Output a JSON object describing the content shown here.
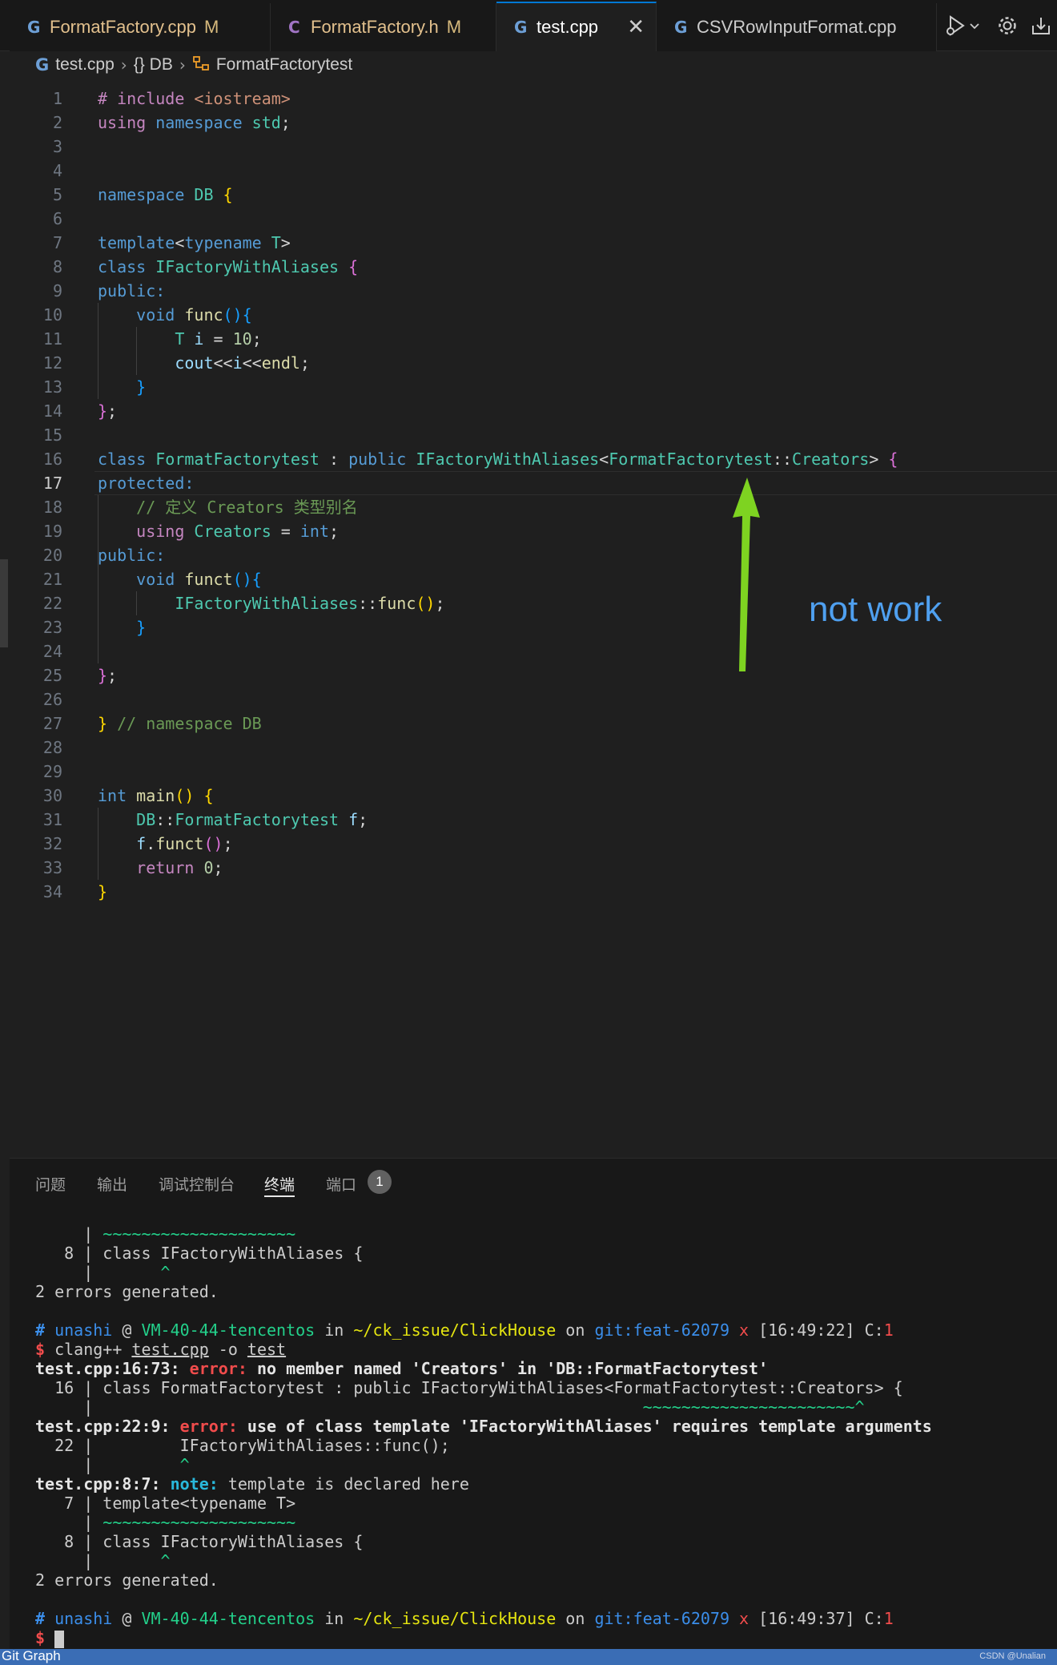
{
  "tabs": [
    {
      "label": "FormatFactory.cpp",
      "modified": "M",
      "icon": "cpp-file-icon",
      "color": "#e2c08d"
    },
    {
      "label": "FormatFactory.h",
      "modified": "M",
      "icon": "c-header-file-icon",
      "color": "#e2c08d"
    },
    {
      "label": "test.cpp",
      "modified": "",
      "icon": "cpp-file-icon",
      "active": true,
      "close": "✕"
    },
    {
      "label": "CSVRowInputFormat.cpp",
      "modified": "",
      "icon": "cpp-file-icon"
    }
  ],
  "toolbar_icons": [
    "run-debug-icon",
    "chevron-down-icon",
    "gear-icon",
    "download-icon"
  ],
  "breadcrumb": {
    "file": "test.cpp",
    "namespace": "{} DB",
    "symbol": "FormatFactorytest"
  },
  "editor": {
    "current_line": 17,
    "lines": [
      {
        "n": "1",
        "tokens": [
          {
            "t": "# include ",
            "c": "k2"
          },
          {
            "t": "<iostream>",
            "c": "s"
          }
        ]
      },
      {
        "n": "2",
        "tokens": [
          {
            "t": "using ",
            "c": "k2"
          },
          {
            "t": "namespace ",
            "c": "k"
          },
          {
            "t": "std",
            "c": "t"
          },
          {
            "t": ";",
            "c": "p"
          }
        ]
      },
      {
        "n": "3",
        "tokens": []
      },
      {
        "n": "4",
        "tokens": []
      },
      {
        "n": "5",
        "tokens": [
          {
            "t": "namespace ",
            "c": "k"
          },
          {
            "t": "DB ",
            "c": "t"
          },
          {
            "t": "{",
            "c": "b1"
          }
        ]
      },
      {
        "n": "6",
        "tokens": []
      },
      {
        "n": "7",
        "tokens": [
          {
            "t": "template",
            "c": "k"
          },
          {
            "t": "<",
            "c": "p"
          },
          {
            "t": "typename ",
            "c": "k"
          },
          {
            "t": "T",
            "c": "t"
          },
          {
            "t": ">",
            "c": "p"
          }
        ]
      },
      {
        "n": "8",
        "tokens": [
          {
            "t": "class ",
            "c": "k"
          },
          {
            "t": "IFactoryWithAliases ",
            "c": "t"
          },
          {
            "t": "{",
            "c": "b2"
          }
        ]
      },
      {
        "n": "9",
        "tokens": [
          {
            "t": "public:",
            "c": "k"
          }
        ]
      },
      {
        "n": "10",
        "tokens": [
          {
            "t": "    void ",
            "c": "k"
          },
          {
            "t": "func",
            "c": "f"
          },
          {
            "t": "(){",
            "c": "b3"
          }
        ]
      },
      {
        "n": "11",
        "tokens": [
          {
            "t": "        T ",
            "c": "t"
          },
          {
            "t": "i",
            "c": "v"
          },
          {
            "t": " = ",
            "c": "p"
          },
          {
            "t": "10",
            "c": "n"
          },
          {
            "t": ";",
            "c": "p"
          }
        ]
      },
      {
        "n": "12",
        "tokens": [
          {
            "t": "        cout",
            "c": "v"
          },
          {
            "t": "<<",
            "c": "p"
          },
          {
            "t": "i",
            "c": "v"
          },
          {
            "t": "<<",
            "c": "p"
          },
          {
            "t": "endl",
            "c": "f"
          },
          {
            "t": ";",
            "c": "p"
          }
        ]
      },
      {
        "n": "13",
        "tokens": [
          {
            "t": "    }",
            "c": "b3"
          }
        ]
      },
      {
        "n": "14",
        "tokens": [
          {
            "t": "}",
            "c": "b2"
          },
          {
            "t": ";",
            "c": "p"
          }
        ]
      },
      {
        "n": "15",
        "tokens": []
      },
      {
        "n": "16",
        "tokens": [
          {
            "t": "class ",
            "c": "k"
          },
          {
            "t": "FormatFactorytest",
            "c": "t"
          },
          {
            "t": " : ",
            "c": "p"
          },
          {
            "t": "public ",
            "c": "k"
          },
          {
            "t": "IFactoryWithAliases",
            "c": "t"
          },
          {
            "t": "<",
            "c": "p"
          },
          {
            "t": "FormatFactorytest",
            "c": "t"
          },
          {
            "t": "::",
            "c": "p"
          },
          {
            "t": "Creators",
            "c": "t"
          },
          {
            "t": "> ",
            "c": "p"
          },
          {
            "t": "{",
            "c": "b2"
          }
        ]
      },
      {
        "n": "17",
        "tokens": [
          {
            "t": "protected:",
            "c": "k"
          }
        ]
      },
      {
        "n": "18",
        "tokens": [
          {
            "t": "    // 定义 Creators 类型别名",
            "c": "c"
          }
        ]
      },
      {
        "n": "19",
        "tokens": [
          {
            "t": "    using ",
            "c": "k2"
          },
          {
            "t": "Creators",
            "c": "t"
          },
          {
            "t": " = ",
            "c": "p"
          },
          {
            "t": "int",
            "c": "k"
          },
          {
            "t": ";",
            "c": "p"
          }
        ]
      },
      {
        "n": "20",
        "tokens": [
          {
            "t": "public:",
            "c": "k"
          }
        ]
      },
      {
        "n": "21",
        "tokens": [
          {
            "t": "    void ",
            "c": "k"
          },
          {
            "t": "funct",
            "c": "f"
          },
          {
            "t": "(){",
            "c": "b3"
          }
        ]
      },
      {
        "n": "22",
        "tokens": [
          {
            "t": "        IFactoryWithAliases",
            "c": "t"
          },
          {
            "t": "::",
            "c": "p"
          },
          {
            "t": "func",
            "c": "f"
          },
          {
            "t": "()",
            "c": "b1"
          },
          {
            "t": ";",
            "c": "p"
          }
        ]
      },
      {
        "n": "23",
        "tokens": [
          {
            "t": "    }",
            "c": "b3"
          }
        ]
      },
      {
        "n": "24",
        "tokens": []
      },
      {
        "n": "25",
        "tokens": [
          {
            "t": "}",
            "c": "b2"
          },
          {
            "t": ";",
            "c": "p"
          }
        ]
      },
      {
        "n": "26",
        "tokens": []
      },
      {
        "n": "27",
        "tokens": [
          {
            "t": "} ",
            "c": "b1"
          },
          {
            "t": "// namespace DB",
            "c": "c"
          }
        ]
      },
      {
        "n": "28",
        "tokens": []
      },
      {
        "n": "29",
        "tokens": []
      },
      {
        "n": "30",
        "tokens": [
          {
            "t": "int ",
            "c": "k"
          },
          {
            "t": "main",
            "c": "f"
          },
          {
            "t": "() {",
            "c": "b1"
          }
        ]
      },
      {
        "n": "31",
        "tokens": [
          {
            "t": "    DB",
            "c": "t"
          },
          {
            "t": "::",
            "c": "p"
          },
          {
            "t": "FormatFactorytest ",
            "c": "t"
          },
          {
            "t": "f",
            "c": "v"
          },
          {
            "t": ";",
            "c": "p"
          }
        ]
      },
      {
        "n": "32",
        "tokens": [
          {
            "t": "    f",
            "c": "v"
          },
          {
            "t": ".",
            "c": "p"
          },
          {
            "t": "funct",
            "c": "f"
          },
          {
            "t": "()",
            "c": "b2"
          },
          {
            "t": ";",
            "c": "p"
          }
        ]
      },
      {
        "n": "33",
        "tokens": [
          {
            "t": "    return ",
            "c": "k2"
          },
          {
            "t": "0",
            "c": "n"
          },
          {
            "t": ";",
            "c": "p"
          }
        ]
      },
      {
        "n": "34",
        "tokens": [
          {
            "t": "}",
            "c": "b1"
          }
        ]
      }
    ]
  },
  "annotation": {
    "text": "not work",
    "color": "#7ed321"
  },
  "panel": {
    "tabs": [
      "问题",
      "输出",
      "调试控制台",
      "终端",
      "端口"
    ],
    "active_tab": "终端",
    "ports_badge": "1"
  },
  "terminal": {
    "lines": [
      [
        {
          "t": "     | ",
          "c": ""
        },
        {
          "t": "~~~~~~~~~~~~~~~~~~~~",
          "c": "tg"
        }
      ],
      [
        {
          "t": "   8 | class IFactoryWithAliases {",
          "c": ""
        }
      ],
      [
        {
          "t": "     |       ",
          "c": ""
        },
        {
          "t": "^",
          "c": "tg"
        }
      ],
      [
        {
          "t": "2 errors generated.",
          "c": ""
        }
      ],
      [],
      [
        {
          "t": "# ",
          "c": "tb"
        },
        {
          "t": "unashi",
          "c": "tblue"
        },
        {
          "t": " @ ",
          "c": ""
        },
        {
          "t": "VM-40-44-tencentos",
          "c": "tg"
        },
        {
          "t": " in ",
          "c": ""
        },
        {
          "t": "~/ck_issue/ClickHouse",
          "c": "ty"
        },
        {
          "t": " on ",
          "c": ""
        },
        {
          "t": "git:feat-62079",
          "c": "tblue"
        },
        {
          "t": " x ",
          "c": "tr"
        },
        {
          "t": "[16:49:22] C:",
          "c": ""
        },
        {
          "t": "1",
          "c": "tr"
        }
      ],
      [
        {
          "t": "$ ",
          "c": "tred"
        },
        {
          "t": "clang++ ",
          "c": ""
        },
        {
          "t": "test.cpp",
          "c": "tu"
        },
        {
          "t": " -o ",
          "c": ""
        },
        {
          "t": "test",
          "c": "tu"
        }
      ],
      [
        {
          "t": "test.cpp:16:73: ",
          "c": "tbold"
        },
        {
          "t": "error: ",
          "c": "tred"
        },
        {
          "t": "no member named 'Creators' in 'DB::FormatFactorytest'",
          "c": "tbold"
        }
      ],
      [
        {
          "t": "  16 | class FormatFactorytest : public IFactoryWithAliases<FormatFactorytest::Creators> {",
          "c": ""
        }
      ],
      [
        {
          "t": "     |                                                         ",
          "c": ""
        },
        {
          "t": "~~~~~~~~~~~~~~~~~~~~~~^",
          "c": "tg"
        }
      ],
      [
        {
          "t": "test.cpp:22:9: ",
          "c": "tbold"
        },
        {
          "t": "error: ",
          "c": "tred"
        },
        {
          "t": "use of class template 'IFactoryWithAliases' requires template arguments",
          "c": "tbold"
        }
      ],
      [
        {
          "t": "  22 |         IFactoryWithAliases::func();",
          "c": ""
        }
      ],
      [
        {
          "t": "     |         ",
          "c": ""
        },
        {
          "t": "^",
          "c": "tg"
        }
      ],
      [
        {
          "t": "test.cpp:8:7: ",
          "c": "tbold"
        },
        {
          "t": "note: ",
          "c": "tnote"
        },
        {
          "t": "template is declared here",
          "c": ""
        }
      ],
      [
        {
          "t": "   7 | template<typename T>",
          "c": ""
        }
      ],
      [
        {
          "t": "     | ",
          "c": ""
        },
        {
          "t": "~~~~~~~~~~~~~~~~~~~~",
          "c": "tg"
        }
      ],
      [
        {
          "t": "   8 | class IFactoryWithAliases {",
          "c": ""
        }
      ],
      [
        {
          "t": "     |       ",
          "c": ""
        },
        {
          "t": "^",
          "c": "tg"
        }
      ],
      [
        {
          "t": "2 errors generated.",
          "c": ""
        }
      ],
      [],
      [
        {
          "t": "# ",
          "c": "tb"
        },
        {
          "t": "unashi",
          "c": "tblue"
        },
        {
          "t": " @ ",
          "c": ""
        },
        {
          "t": "VM-40-44-tencentos",
          "c": "tg"
        },
        {
          "t": " in ",
          "c": ""
        },
        {
          "t": "~/ck_issue/ClickHouse",
          "c": "ty"
        },
        {
          "t": " on ",
          "c": ""
        },
        {
          "t": "git:feat-62079",
          "c": "tblue"
        },
        {
          "t": " x ",
          "c": "tr"
        },
        {
          "t": "[16:49:37] C:",
          "c": ""
        },
        {
          "t": "1",
          "c": "tr"
        }
      ],
      [
        {
          "t": "$ ",
          "c": "tred"
        },
        {
          "t": "",
          "c": "cursor"
        }
      ]
    ]
  },
  "statusbar": {
    "git_graph": "Git Graph",
    "watermark": "CSDN @Unalian"
  }
}
